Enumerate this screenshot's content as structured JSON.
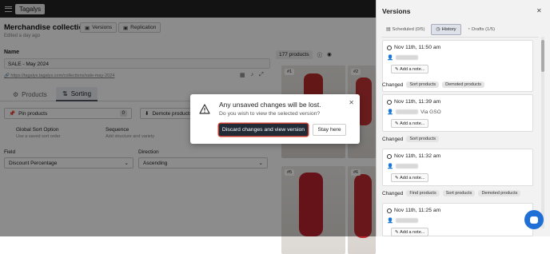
{
  "topbar": {
    "brand": "Tagalys"
  },
  "page": {
    "title": "Merchandise collection",
    "subtitle": "Edited a day ago",
    "versions_button": "Versions",
    "replication_button": "Replication",
    "name_label": "Name",
    "name_value": "SALE - May 2024",
    "url": "https://tagalys.tagalys.com/collections/sale-may-2024",
    "products_count": "177 products"
  },
  "tabs": [
    {
      "label": "Products"
    },
    {
      "label": "Sorting"
    }
  ],
  "sorting": {
    "pin_label": "Pin products",
    "pin_count": "0",
    "demote_label": "Demote products",
    "global_title": "Global Sort Option",
    "global_desc": "Use a saved sort order",
    "sequence_title": "Sequence",
    "sequence_desc": "Add structure and variety",
    "field_label": "Field",
    "field_value": "Discount Percentage",
    "direction_label": "Direction",
    "direction_value": "Ascending"
  },
  "photos": [
    {
      "num": "#1"
    },
    {
      "num": "#2"
    },
    {
      "num": "#5"
    },
    {
      "num": "#6"
    }
  ],
  "modal": {
    "title": "Any unsaved changes will be lost.",
    "subtitle": "Do you wish to view the selected version?",
    "discard_button": "Discard changes and view version",
    "stay_button": "Stay here"
  },
  "panel": {
    "title": "Versions",
    "tabs": [
      {
        "label": "Scheduled (0/5)"
      },
      {
        "label": "History"
      },
      {
        "label": "Drafts (1/5)"
      }
    ],
    "add_note": "Add a note...",
    "changed_label": "Changed",
    "versions": [
      {
        "date": "Nov 11th, 11:50 am",
        "via": "",
        "changes": [
          "Sort products",
          "Demoted products"
        ]
      },
      {
        "date": "Nov 11th, 11:39 am",
        "via": "Via GSO",
        "changes": [
          "Sort products"
        ]
      },
      {
        "date": "Nov 11th, 11:32 am",
        "via": "",
        "changes": [
          "Find products",
          "Sort products",
          "Demoted products"
        ]
      },
      {
        "date": "Nov 11th, 11:25 am",
        "via": "",
        "changes": []
      }
    ]
  },
  "colors": {
    "topbar": "#232323",
    "primary_button": "#222a36",
    "chat": "#1f6fd6"
  }
}
